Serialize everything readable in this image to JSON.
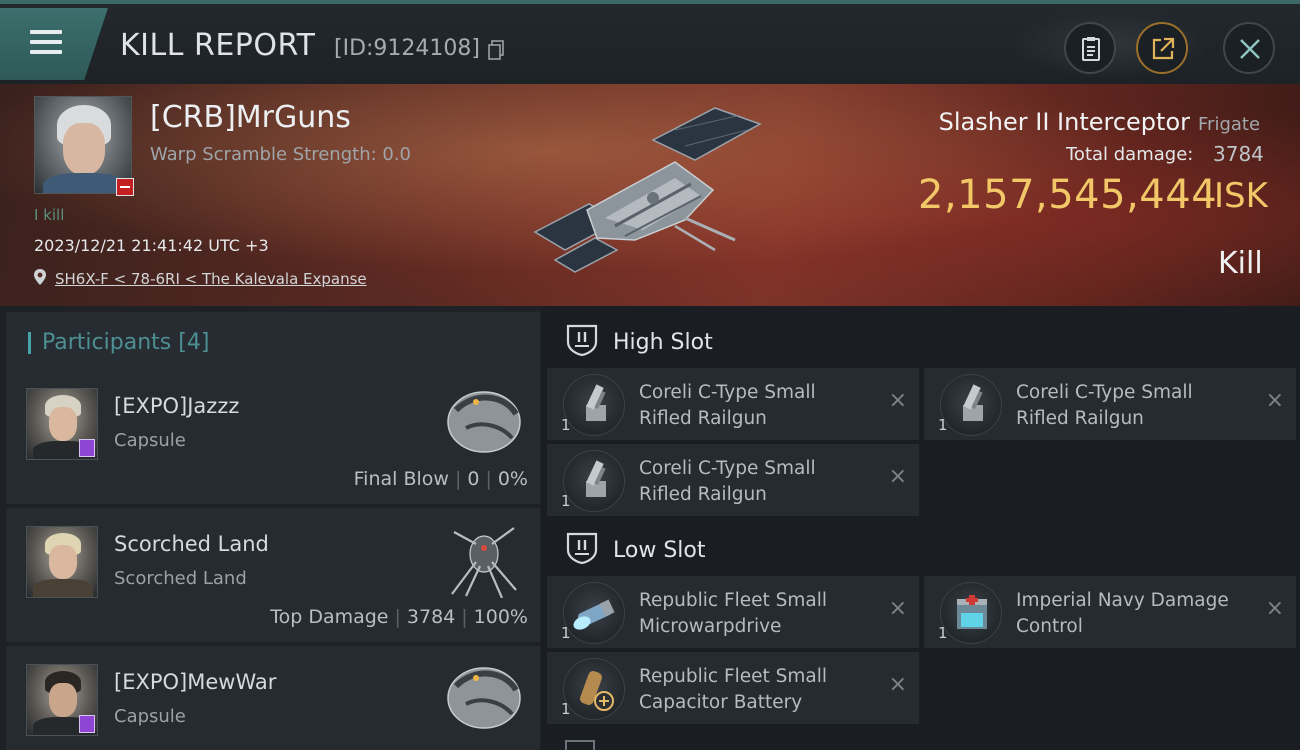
{
  "header": {
    "title": "KILL REPORT",
    "report_id": "[ID:9124108]",
    "icons": [
      "menu-icon",
      "copy-icon",
      "clipboard-icon",
      "share-icon",
      "close-icon"
    ]
  },
  "victim": {
    "pilot_name": "[CRB]MrGuns",
    "warp_scramble": "Warp Scramble Strength: 0.0",
    "kill_tag": "Ⅰ kill",
    "datetime": "2023/12/21 21:41:42 UTC +3",
    "location": "SH6X-F < 78-6RI < The Kalevala Expanse",
    "ship_name": "Slasher II Interceptor",
    "ship_class": "Frigate",
    "total_damage_label": "Total damage:",
    "total_damage_value": "3784",
    "isk_value": "2,157,545,444",
    "isk_unit": "ISK",
    "result": "Kill"
  },
  "participants": {
    "label": "Participants",
    "count": "[4]",
    "rows": [
      {
        "name": "[EXPO]Jazzz",
        "ship": "Capsule",
        "stat_label": "Final Blow",
        "damage": "0",
        "percent": "0%"
      },
      {
        "name": "Scorched Land",
        "ship": "Scorched Land",
        "stat_label": "Top Damage",
        "damage": "3784",
        "percent": "100%"
      },
      {
        "name": "[EXPO]MewWar",
        "ship": "Capsule"
      }
    ]
  },
  "fitting": {
    "high_slot": {
      "label": "High Slot",
      "modules": [
        {
          "name": "Coreli C-Type Small Rifled Railgun",
          "qty": "1"
        },
        {
          "name": "Coreli C-Type Small Rifled Railgun",
          "qty": "1"
        },
        {
          "name": "Coreli C-Type Small Rifled Railgun",
          "qty": "1"
        }
      ]
    },
    "low_slot": {
      "label": "Low Slot",
      "modules": [
        {
          "name": "Republic Fleet Small Microwarpdrive",
          "qty": "1"
        },
        {
          "name": "Imperial Navy Damage Control",
          "qty": "1"
        },
        {
          "name": "Republic Fleet Small Capacitor Battery",
          "qty": "1"
        }
      ]
    },
    "remove_glyph": "×"
  },
  "colors": {
    "accent_teal": "#3c6f6d",
    "isk_gold": "#f2c768",
    "badge_red": "#c41f21",
    "badge_purple": "#8f45d4"
  }
}
